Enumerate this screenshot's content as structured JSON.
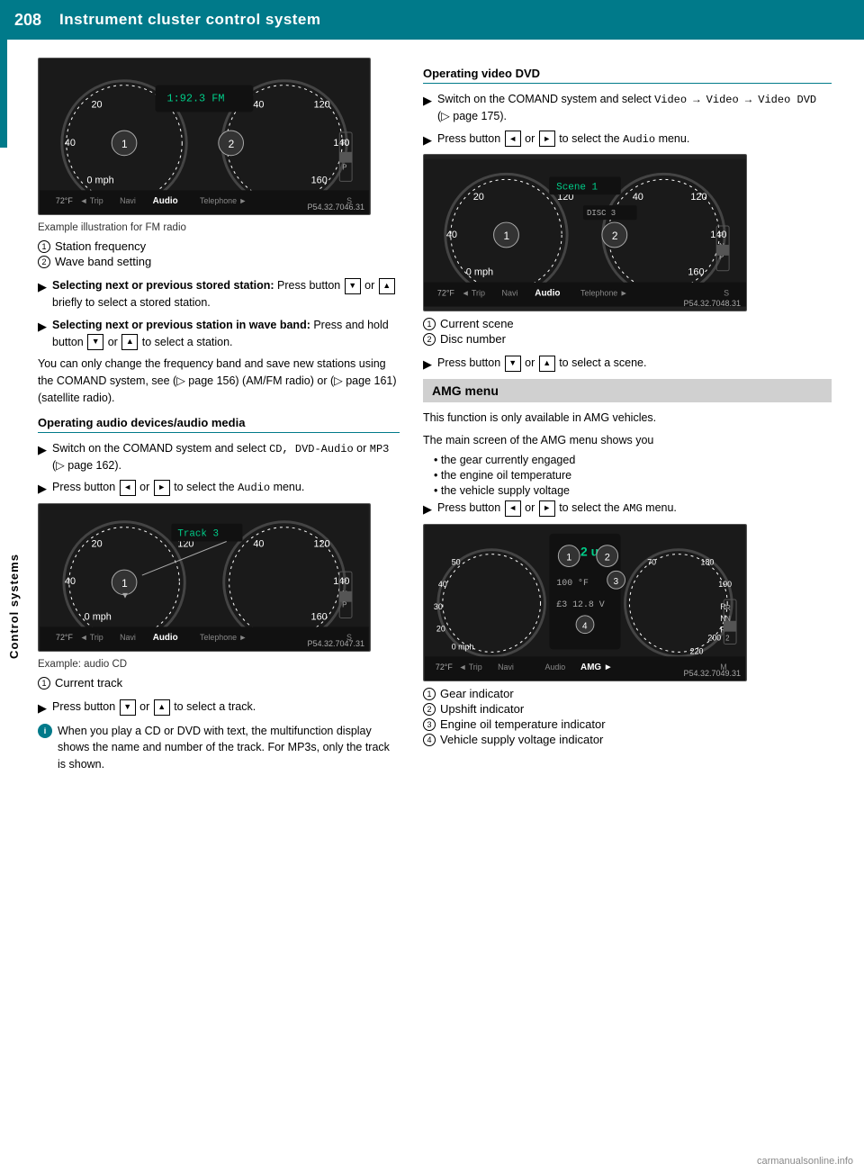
{
  "header": {
    "page_number": "208",
    "title": "Instrument cluster control system"
  },
  "sidebar": {
    "label": "Control systems"
  },
  "left_col": {
    "image1": {
      "alt": "FM radio dashboard display",
      "watermark": "P54.32.7046.31"
    },
    "caption1": {
      "intro": "Example illustration for FM radio",
      "items": [
        {
          "num": "1",
          "text": "Station frequency"
        },
        {
          "num": "2",
          "text": "Wave band setting"
        }
      ]
    },
    "bullets1": [
      {
        "bold_prefix": "Selecting next or previous stored station:",
        "text": " Press button  ▼  or  ▲  briefly to select a stored station."
      },
      {
        "bold_prefix": "Selecting next or previous station in wave band:",
        "text": " Press and hold button  ▼  or  ▲  to select a station."
      }
    ],
    "para1": "You can only change the frequency band and save new stations using the COMAND system, see (▷ page 156) (AM/FM radio) or (▷ page 161) (satellite radio).",
    "section_heading1": "Operating audio devices/audio media",
    "bullets2": [
      {
        "text": "Switch on the COMAND system and select CD, DVD-Audio or MP3 (▷ page 162)."
      },
      {
        "text": "Press button  ◄  or  ►  to select the Audio menu."
      }
    ],
    "image2": {
      "alt": "Audio CD dashboard display",
      "watermark": "P54.32.7047.31"
    },
    "caption2": {
      "intro": "Example: audio CD",
      "items": [
        {
          "num": "1",
          "text": "Current track"
        }
      ]
    },
    "bullets3": [
      {
        "text": "Press button  ▼  or  ▲  to select a track."
      }
    ],
    "info1": {
      "text": "When you play a CD or DVD with text, the multifunction display shows the name and number of the track. For MP3s, only the track is shown."
    }
  },
  "right_col": {
    "section_heading1": "Operating video DVD",
    "bullets1": [
      {
        "text": "Switch on the COMAND system and select Video → Video → Video DVD (▷ page 175)."
      },
      {
        "text": "Press button  ◄  or  ►  to select the Audio menu."
      }
    ],
    "image1": {
      "alt": "Video DVD dashboard display",
      "watermark": "P54.32.7048.31"
    },
    "caption1": {
      "items": [
        {
          "num": "1",
          "text": "Current scene"
        },
        {
          "num": "2",
          "text": "Disc number"
        }
      ]
    },
    "bullets2": [
      {
        "text": "Press button  ▼  or  ▲  to select a scene."
      }
    ],
    "amg_menu_label": "AMG menu",
    "amg_para1": "This function is only available in AMG vehicles.",
    "amg_para2": "The main screen of the AMG menu shows you",
    "amg_sub_bullets": [
      "the gear currently engaged",
      "the engine oil temperature",
      "the vehicle supply voltage"
    ],
    "bullets3": [
      {
        "text": "Press button  ◄  or  ►  to select the AMG menu."
      }
    ],
    "image2": {
      "alt": "AMG menu dashboard display",
      "watermark": "P54.32.7049.31"
    },
    "caption2": {
      "items": [
        {
          "num": "1",
          "text": "Gear indicator"
        },
        {
          "num": "2",
          "text": "Upshift indicator"
        },
        {
          "num": "3",
          "text": "Engine oil temperature indicator"
        },
        {
          "num": "4",
          "text": "Vehicle supply voltage indicator"
        }
      ]
    }
  },
  "bottom_link": "carmanualsonline.info"
}
